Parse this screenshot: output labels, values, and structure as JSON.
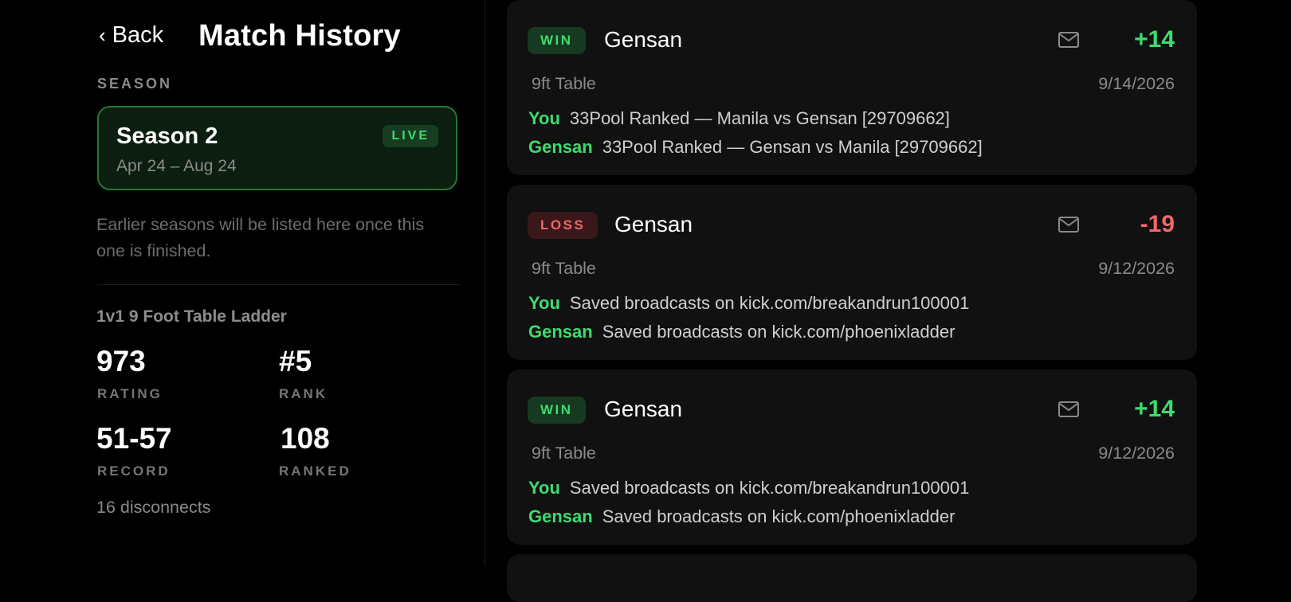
{
  "header": {
    "back_label": "Back",
    "title": "Match History"
  },
  "season": {
    "section_label": "SEASON",
    "name": "Season 2",
    "dates": "Apr 24 – Aug 24",
    "status_badge": "LIVE",
    "note": "Earlier seasons will be listed here once this one is finished."
  },
  "ladder": {
    "name": "1v1 9 Foot Table Ladder",
    "rating": {
      "value": "973",
      "label": "RATING"
    },
    "rank": {
      "value": "#5",
      "label": "RANK"
    },
    "record": {
      "value": "51-57",
      "label": "RECORD"
    },
    "ranked": {
      "value": "108",
      "label": "RANKED"
    },
    "disconnects": "16 disconnects"
  },
  "matches": [
    {
      "result": "WIN",
      "opponent": "Gensan",
      "delta": "+14",
      "table": "9ft Table",
      "date": "9/14/2026",
      "you_label": "You",
      "you_text": "33Pool Ranked — Manila vs Gensan [29709662]",
      "opp_label": "Gensan",
      "opp_text": "33Pool Ranked — Gensan vs Manila [29709662]"
    },
    {
      "result": "LOSS",
      "opponent": "Gensan",
      "delta": "-19",
      "table": "9ft Table",
      "date": "9/12/2026",
      "you_label": "You",
      "you_text": "Saved broadcasts on kick.com/breakandrun100001",
      "opp_label": "Gensan",
      "opp_text": "Saved broadcasts on kick.com/phoenixladder"
    },
    {
      "result": "WIN",
      "opponent": "Gensan",
      "delta": "+14",
      "table": "9ft Table",
      "date": "9/12/2026",
      "you_label": "You",
      "you_text": "Saved broadcasts on kick.com/breakandrun100001",
      "opp_label": "Gensan",
      "opp_text": "Saved broadcasts on kick.com/phoenixladder"
    }
  ],
  "icons": {
    "back": "chevron-left-icon",
    "message": "mail-icon"
  },
  "colors": {
    "win": "#3ddc6f",
    "loss": "#f0686a",
    "live_border": "#1e7a35",
    "card_bg": "#111111"
  }
}
